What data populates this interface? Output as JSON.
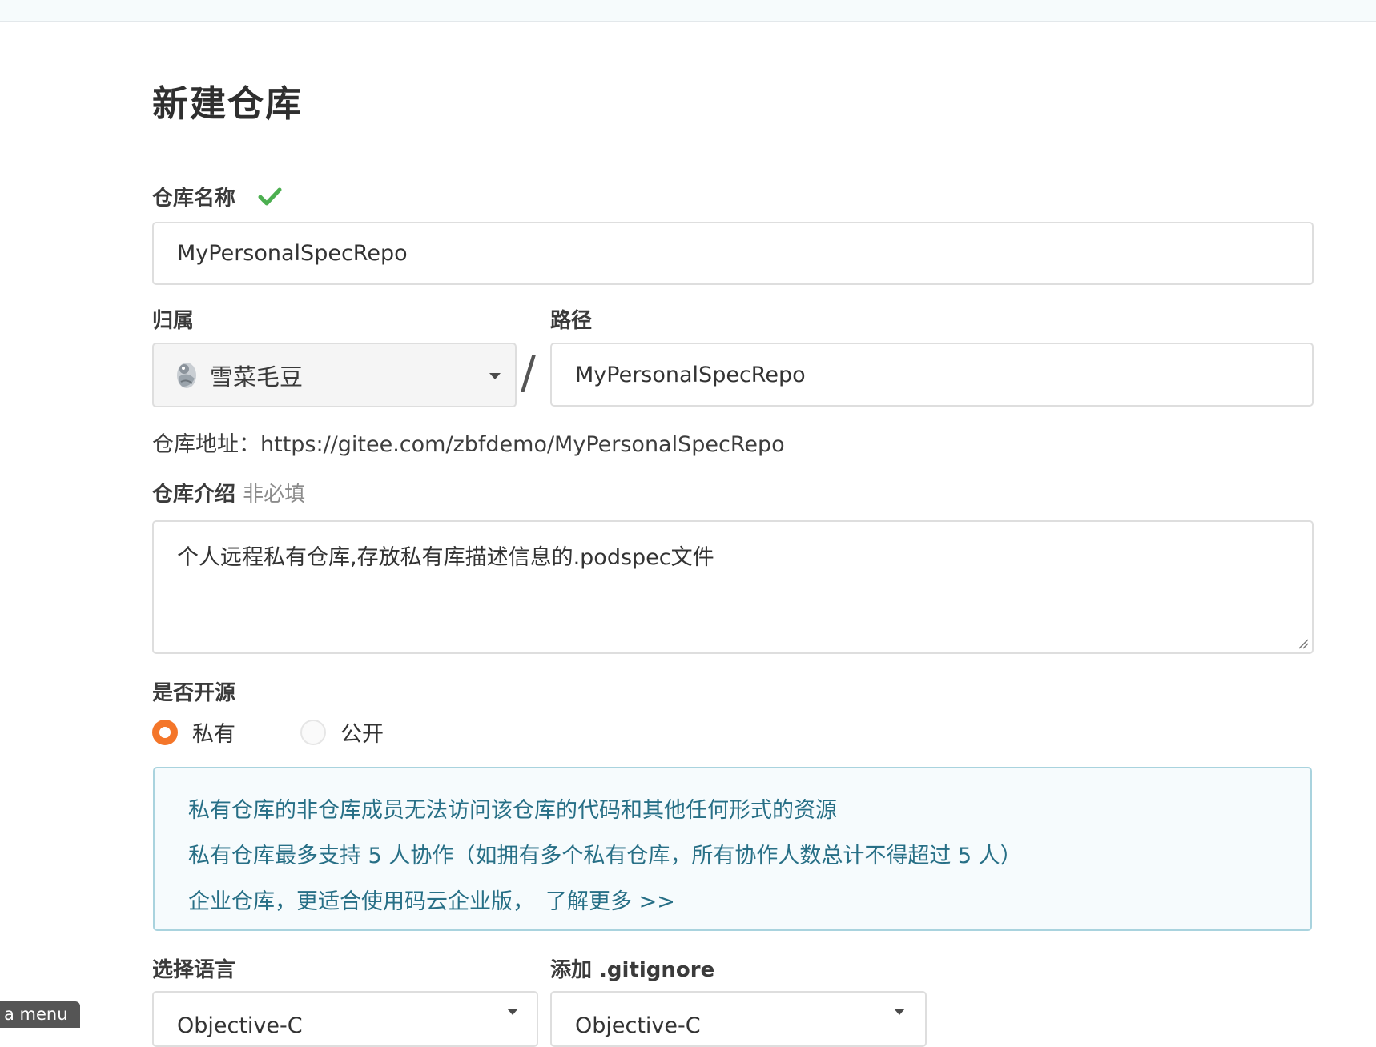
{
  "page": {
    "title": "新建仓库"
  },
  "form": {
    "repo_name": {
      "label": "仓库名称",
      "value": "MyPersonalSpecRepo"
    },
    "owner": {
      "label": "归属",
      "value": "雪菜毛豆"
    },
    "path": {
      "label": "路径",
      "separator": "/",
      "value": "MyPersonalSpecRepo"
    },
    "repo_url": {
      "text": "仓库地址：https://gitee.com/zbfdemo/MyPersonalSpecRepo"
    },
    "description": {
      "label": "仓库介绍",
      "hint": "非必填",
      "value": "个人远程私有仓库,存放私有库描述信息的.podspec文件"
    },
    "visibility": {
      "label": "是否开源",
      "options": [
        {
          "label": "私有",
          "checked": true
        },
        {
          "label": "公开",
          "checked": false
        }
      ]
    },
    "info": {
      "line1": "私有仓库的非仓库成员无法访问该仓库的代码和其他任何形式的资源",
      "line2": "私有仓库最多支持 5 人协作（如拥有多个私有仓库，所有协作人数总计不得超过 5 人）",
      "line3": "企业仓库，更适合使用码云企业版，",
      "link": "了解更多 >>"
    },
    "language": {
      "label": "选择语言",
      "value": "Objective-C"
    },
    "gitignore": {
      "label": "添加 .gitignore",
      "value": "Objective-C"
    }
  },
  "overlay": {
    "menu_tab": "a menu"
  },
  "colors": {
    "accent_orange": "#f4762a",
    "success_green": "#4caf50",
    "info_text": "#276f86",
    "info_border": "#a9d3de"
  },
  "icons": {
    "valid": "check-icon",
    "owner_avatar": "avatar",
    "dropdown": "chevron-down-icon"
  }
}
